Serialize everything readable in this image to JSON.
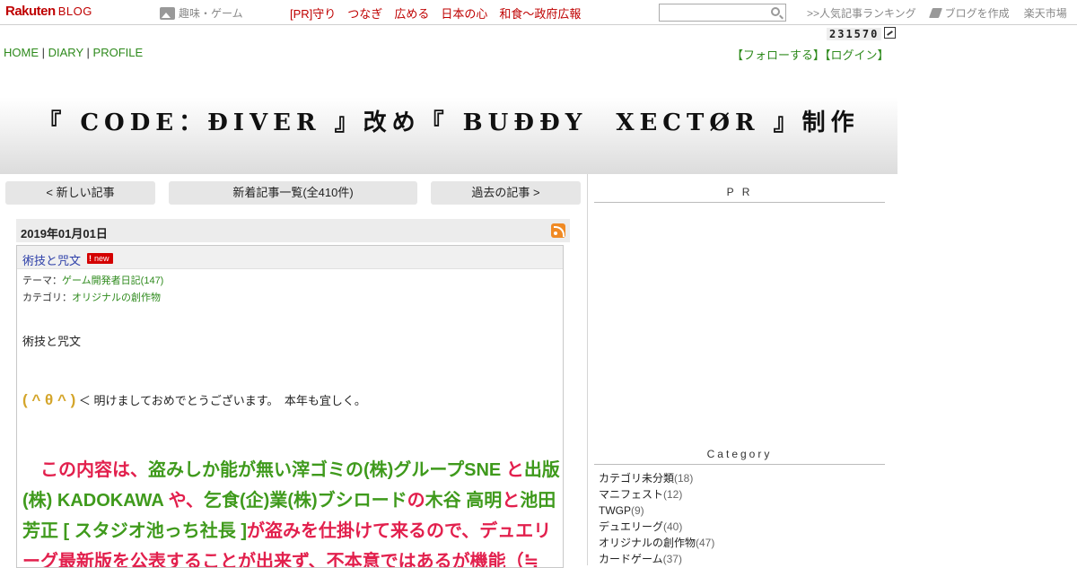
{
  "topbar": {
    "logo": "Rakuten",
    "logo_blog": "BLOG",
    "genre": "趣味・ゲーム",
    "pr_links": [
      "[PR]守り",
      "つなぎ",
      "広める",
      "日本の心",
      "和食～政府広報"
    ],
    "search_placeholder": "",
    "ranking": ">>人気記事ランキング",
    "create_blog": "ブログを作成",
    "market": "楽天市場"
  },
  "counter": "231570",
  "nav": {
    "home": "HOME",
    "diary": "DIARY",
    "profile": "PROFILE",
    "sep": "|"
  },
  "account": {
    "follow": "【フォローする】",
    "login": "【ログイン】"
  },
  "banner": {
    "title": "『 CODE：ĐIVER 』改め『 BUĐĐY　XECTØR 』制作"
  },
  "pager": {
    "newer": "< 新しい記事",
    "list": "新着記事一覧(全410件)",
    "older": "過去の記事 >"
  },
  "post": {
    "date": "2019年01月01日",
    "title": "術技と咒文",
    "new_label": "new",
    "theme_label": "テーマ：",
    "theme_value": "ゲーム開発者日記(147)",
    "category_label": "カテゴリ：",
    "category_value": "オリジナルの創作物",
    "body_title": "術技と咒文",
    "smiley": "( ^ θ ^ )",
    "greeting": "＜ 明けましておめでとうございます。　本年も宜しく。",
    "big_segments": [
      {
        "text": "　この内容は、",
        "color": "red"
      },
      {
        "text": "盗みしか能が無い滓ゴミの(株)グループSNE",
        "color": "green"
      },
      {
        "text": " と",
        "color": "red"
      },
      {
        "text": "出版(株) KADOKAWA",
        "color": "green"
      },
      {
        "text": " や、",
        "color": "red"
      },
      {
        "text": "乞食(企)業(株)ブシロード",
        "color": "green"
      },
      {
        "text": "の",
        "color": "red"
      },
      {
        "text": "木谷 高明",
        "color": "green"
      },
      {
        "text": "と",
        "color": "red"
      },
      {
        "text": "池田 芳正 [ スタジオ池っち社長 ]",
        "color": "green"
      },
      {
        "text": "が盗みを仕掛けて来るので、デュエリーグ最新版を公表することが出来ず、不本意ではあるが機能（≒",
        "color": "red"
      }
    ]
  },
  "sidebar": {
    "pr_title": "P R",
    "category_title": "Category",
    "categories": [
      {
        "name": "カテゴリ未分類",
        "count": "(18)"
      },
      {
        "name": "マニフェスト",
        "count": "(12)"
      },
      {
        "name": "TWGP",
        "count": "(9)"
      },
      {
        "name": "デュエリーグ",
        "count": "(40)"
      },
      {
        "name": "オリジナルの創作物",
        "count": "(47)"
      },
      {
        "name": "カードゲーム",
        "count": "(37)"
      }
    ]
  }
}
